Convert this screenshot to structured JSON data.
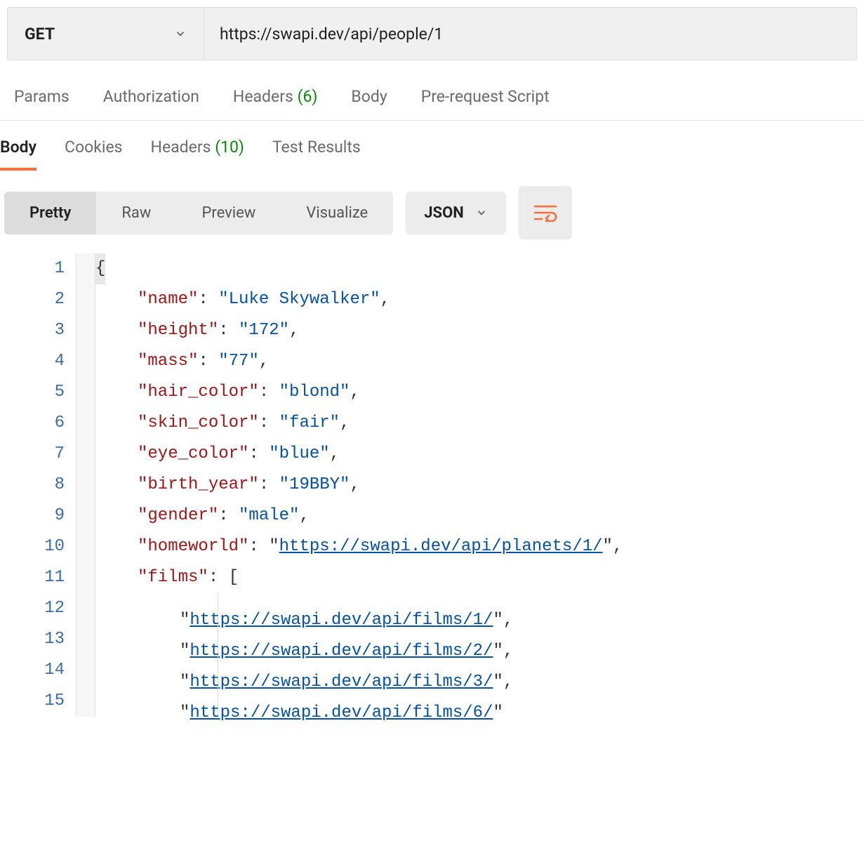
{
  "request": {
    "method": "GET",
    "url": "https://swapi.dev/api/people/1"
  },
  "reqTabs": {
    "params": "Params",
    "authorization": "Authorization",
    "headers_label": "Headers",
    "headers_count": "(6)",
    "body": "Body",
    "prescript": "Pre-request Script"
  },
  "respTabs": {
    "body": "Body",
    "cookies": "Cookies",
    "headers_label": "Headers",
    "headers_count": "(10)",
    "tests": "Test Results"
  },
  "viewModes": {
    "pretty": "Pretty",
    "raw": "Raw",
    "preview": "Preview",
    "visualize": "Visualize"
  },
  "format": "JSON",
  "json_lines": [
    {
      "n": "1",
      "type": "open"
    },
    {
      "n": "2",
      "key": "name",
      "val": "Luke Skywalker",
      "kind": "str"
    },
    {
      "n": "3",
      "key": "height",
      "val": "172",
      "kind": "str"
    },
    {
      "n": "4",
      "key": "mass",
      "val": "77",
      "kind": "str"
    },
    {
      "n": "5",
      "key": "hair_color",
      "val": "blond",
      "kind": "str"
    },
    {
      "n": "6",
      "key": "skin_color",
      "val": "fair",
      "kind": "str"
    },
    {
      "n": "7",
      "key": "eye_color",
      "val": "blue",
      "kind": "str"
    },
    {
      "n": "8",
      "key": "birth_year",
      "val": "19BBY",
      "kind": "str"
    },
    {
      "n": "9",
      "key": "gender",
      "val": "male",
      "kind": "str"
    },
    {
      "n": "10",
      "key": "homeworld",
      "val": "https://swapi.dev/api/planets/1/",
      "kind": "url"
    },
    {
      "n": "11",
      "key": "films",
      "kind": "arr_open"
    },
    {
      "n": "12",
      "val": "https://swapi.dev/api/films/1/",
      "kind": "arr_item"
    },
    {
      "n": "13",
      "val": "https://swapi.dev/api/films/2/",
      "kind": "arr_item"
    },
    {
      "n": "14",
      "val": "https://swapi.dev/api/films/3/",
      "kind": "arr_item"
    },
    {
      "n": "15",
      "val": "https://swapi.dev/api/films/6/",
      "kind": "arr_item_partial"
    }
  ]
}
